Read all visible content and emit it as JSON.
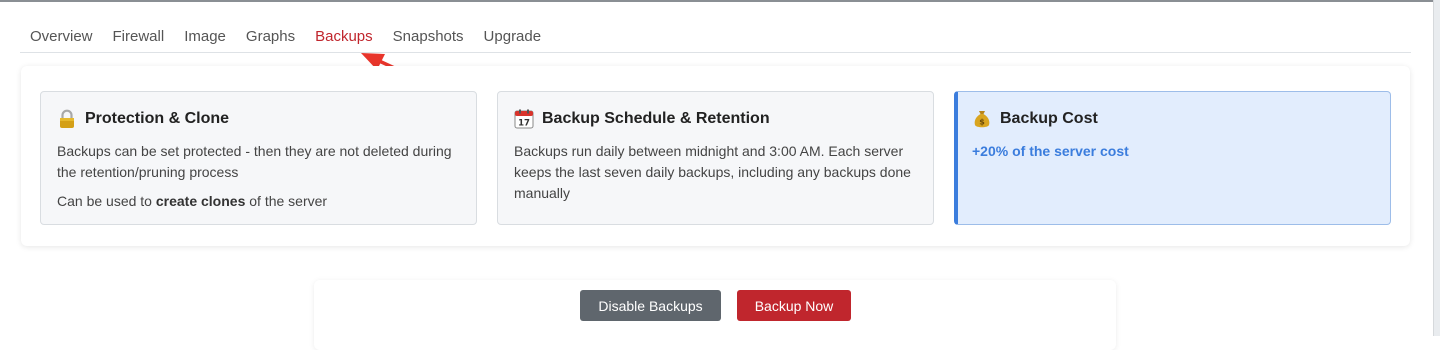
{
  "tabs": [
    {
      "label": "Overview",
      "active": false
    },
    {
      "label": "Firewall",
      "active": false
    },
    {
      "label": "Image",
      "active": false
    },
    {
      "label": "Graphs",
      "active": false
    },
    {
      "label": "Backups",
      "active": true
    },
    {
      "label": "Snapshots",
      "active": false
    },
    {
      "label": "Upgrade",
      "active": false
    }
  ],
  "cards": {
    "protection": {
      "icon": "lock-icon",
      "title": "Protection & Clone",
      "text1": "Backups can be set protected - then they are not deleted during the retention/pruning process",
      "text2_prefix": "Can be used to ",
      "text2_bold": "create clones",
      "text2_suffix": " of the server"
    },
    "schedule": {
      "icon": "calendar-icon",
      "title": "Backup Schedule & Retention",
      "text1": "Backups run daily between midnight and 3:00 AM. Each server keeps the last seven daily backups, including any backups done manually"
    },
    "cost": {
      "icon": "money-bag-icon",
      "title": "Backup Cost",
      "text": "+20% of the server cost"
    }
  },
  "actions": {
    "disable_label": "Disable Backups",
    "backup_label": "Backup Now"
  },
  "colors": {
    "accent_red": "#c0262d",
    "info_blue": "#3b7ddd",
    "secondary_gray": "#5f666d"
  }
}
